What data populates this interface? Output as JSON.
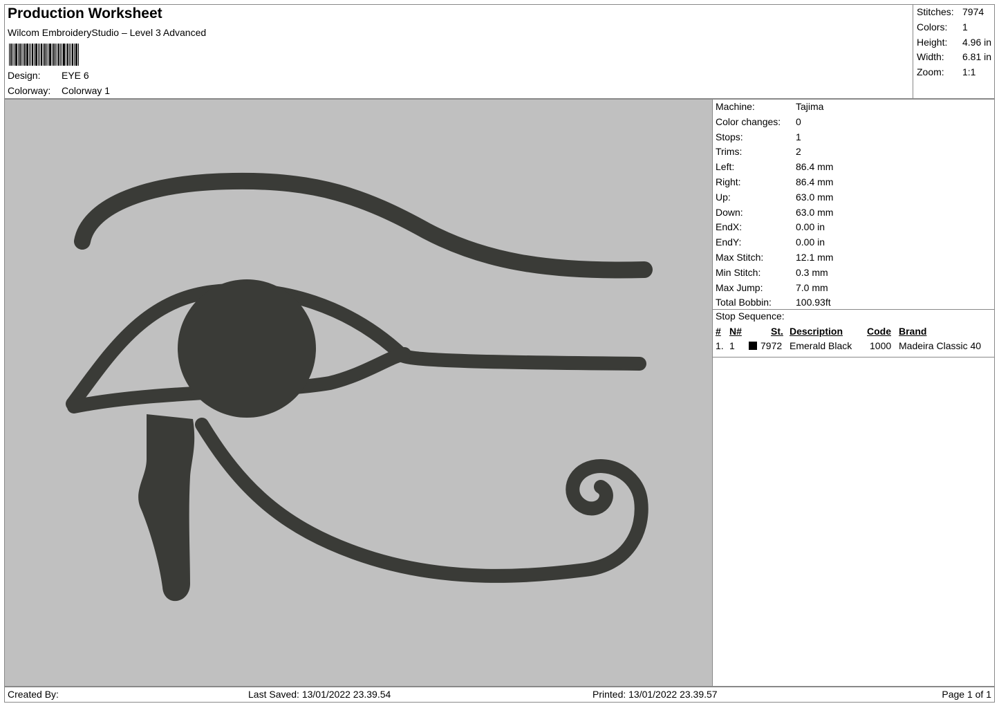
{
  "header": {
    "title": "Production Worksheet",
    "subtitle": "Wilcom EmbroideryStudio – Level 3 Advanced",
    "design_label": "Design:",
    "design_value": "EYE 6",
    "colorway_label": "Colorway:",
    "colorway_value": "Colorway 1"
  },
  "summary": [
    {
      "label": "Stitches:",
      "value": "7974"
    },
    {
      "label": "Colors:",
      "value": "1"
    },
    {
      "label": "Height:",
      "value": "4.96 in"
    },
    {
      "label": "Width:",
      "value": "6.81 in"
    },
    {
      "label": "Zoom:",
      "value": "1:1"
    }
  ],
  "machine": [
    {
      "label": "Machine:",
      "value": "Tajima"
    },
    {
      "label": "Color changes:",
      "value": "0"
    },
    {
      "label": "Stops:",
      "value": "1"
    },
    {
      "label": "Trims:",
      "value": "2"
    },
    {
      "label": "Left:",
      "value": "86.4 mm"
    },
    {
      "label": "Right:",
      "value": "86.4 mm"
    },
    {
      "label": "Up:",
      "value": "63.0 mm"
    },
    {
      "label": "Down:",
      "value": "63.0 mm"
    },
    {
      "label": "EndX:",
      "value": "0.00 in"
    },
    {
      "label": "EndY:",
      "value": "0.00 in"
    },
    {
      "label": "Max Stitch:",
      "value": "12.1 mm"
    },
    {
      "label": "Min Stitch:",
      "value": "0.3 mm"
    },
    {
      "label": "Max Jump:",
      "value": "7.0 mm"
    },
    {
      "label": "Total Bobbin:",
      "value": "100.93ft"
    }
  ],
  "stop_sequence": {
    "title": "Stop Sequence:",
    "headers": {
      "num": "#",
      "n": "N#",
      "st": "St.",
      "description": "Description",
      "code": "Code",
      "brand": "Brand"
    },
    "rows": [
      {
        "num": "1.",
        "n": "1",
        "swatch_color": "#000000",
        "st": "7972",
        "description": "Emerald Black",
        "code": "1000",
        "brand": "Madeira Classic 40"
      }
    ]
  },
  "design": {
    "fill_color": "#3a3b37",
    "background_color": "#c0c0c0"
  },
  "footer": {
    "created_by": "Created By:",
    "last_saved": "Last Saved: 13/01/2022 23.39.54",
    "printed": "Printed: 13/01/2022 23.39.57",
    "page": "Page 1 of 1"
  }
}
